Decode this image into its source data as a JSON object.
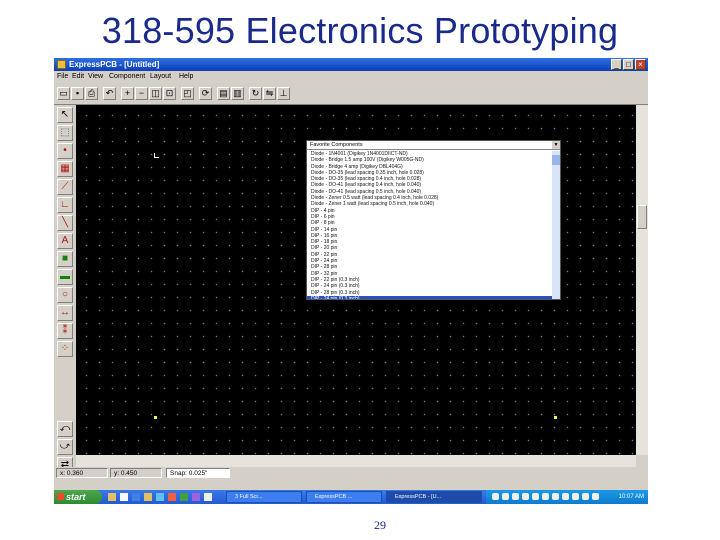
{
  "slide": {
    "title": "318-595 Electronics Prototyping",
    "page_number": "29"
  },
  "window": {
    "title": "ExpressPCB - [Untitled]",
    "controls": {
      "minimize": "_",
      "maximize": "□",
      "close": "×"
    }
  },
  "menu": [
    "File",
    "Edit",
    "View",
    "Component",
    "Layout",
    "Help"
  ],
  "toolbar_icons": [
    "open-icon",
    "save-icon",
    "print-icon",
    "undo-icon",
    "zoom-in-icon",
    "zoom-out-icon",
    "zoom-area-icon",
    "zoom-fit-icon",
    "zoom-board-icon",
    "refresh-icon",
    "layer-top-icon",
    "layer-bottom-icon",
    "rotate-icon",
    "flip-icon",
    "align-icon"
  ],
  "left_tools": [
    "pointer-icon",
    "select-area-icon",
    "pad-icon",
    "component-icon",
    "trace-icon",
    "corner-icon",
    "diagonal-icon",
    "text-icon",
    "layer-icon",
    "fill-icon",
    "circle-icon",
    "dimension-icon",
    "via-icon",
    "part-icon"
  ],
  "component_dropdown": {
    "header": "Favorite Components",
    "items": [
      "Diode - 1N4001 (Digikey 1N4001DIICT-ND)",
      "Diode - Bridge 1.5 amp 100V (Digikey W005G-ND)",
      "Diode - Bridge 4 amp (Digikey DBL404G)",
      "Diode - DO-35 (lead spacing 0.35 inch, hole 0.028)",
      "Diode - DO-35 (lead spacing 0.4 inch, hole 0.028)",
      "Diode - DO-41 (lead spacing 0.4 inch, hole 0.040)",
      "Diode - DO-41 (lead spacing 0.5 inch, hole 0.040)",
      "Diode - Zener 0.5 watt (lead spacing 0.4 inch, hole 0.028)",
      "Diode - Zener 1 watt (lead spacing 0.5 inch, hole 0.040)",
      "DIP - 4 pin",
      "DIP - 6 pin",
      "DIP - 8 pin",
      "DIP - 14 pin",
      "DIP - 16 pin",
      "DIP - 18 pin",
      "DIP - 20 pin",
      "DIP - 22 pin",
      "DIP - 24 pin",
      "DIP - 28 pin",
      "DIP - 32 pin",
      "DIP - 22 pin (0.3 inch)",
      "DIP - 24 pin (0.3 inch)",
      "DIP - 28 pin (0.3 inch)",
      "DIP - 24 pin (0.3 inch)"
    ],
    "selected_index": 23
  },
  "status": {
    "x": "x: 0.360",
    "y": "y: 0.450",
    "snap": "Snap: 0.025\""
  },
  "taskbar": {
    "start_label": "start",
    "tasks": [
      "3 Full Scr...",
      "ExpressPCB ...",
      "ExpressPCB - [U..."
    ],
    "active_task": 2,
    "clock": "10:07 AM"
  },
  "colors": {
    "title_blue": "#1a2a8a",
    "canvas": "#000000",
    "xp_blue": "#245bd0",
    "selection": "#2850c0",
    "marker": "#f0f060"
  }
}
